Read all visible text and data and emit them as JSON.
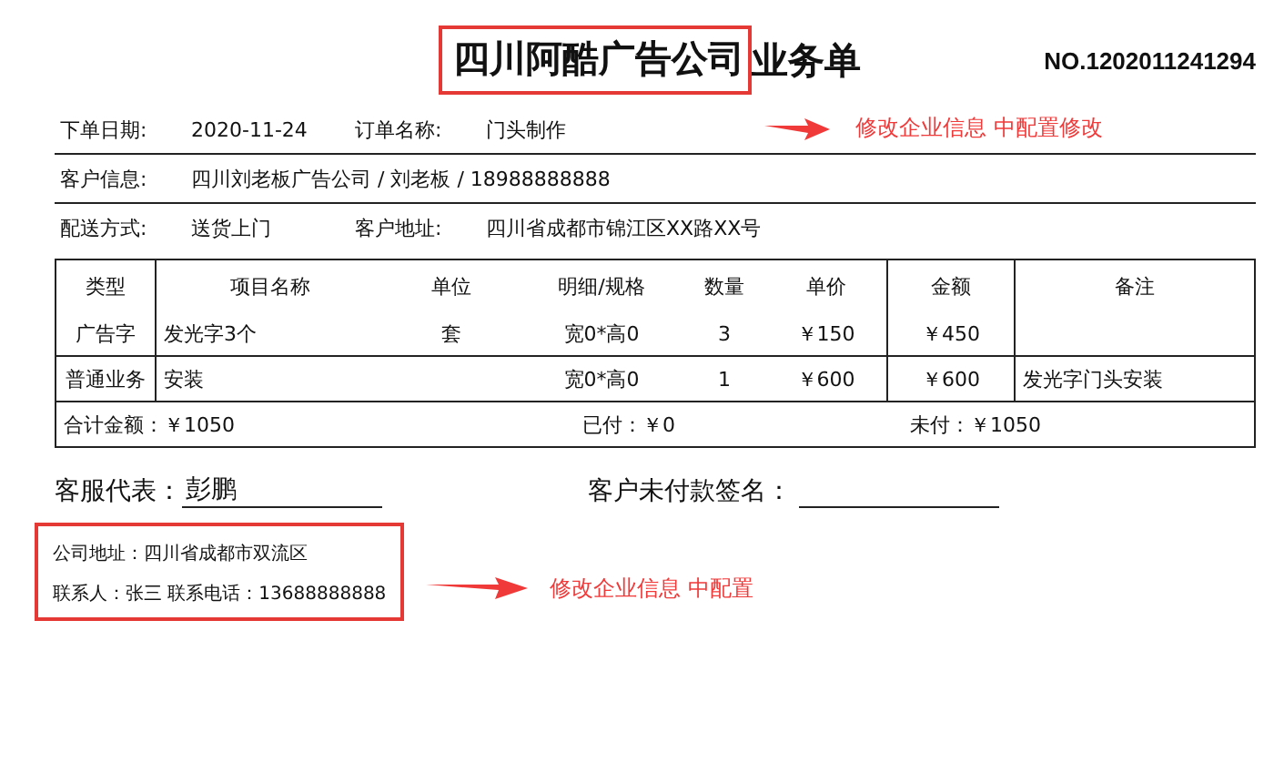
{
  "header": {
    "title_highlighted": "四川阿酷广告公司",
    "title_rest": "业务单",
    "number": "NO.1202011241294"
  },
  "annotations": [
    {
      "text": "修改企业信息 中配置修改"
    },
    {
      "text": "修改企业信息  中配置"
    }
  ],
  "info_rows": [
    [
      {
        "label": "下单日期:",
        "value": "2020-11-24"
      },
      {
        "label": "订单名称:",
        "value": "门头制作"
      }
    ],
    [
      {
        "label": "客户信息:",
        "value": "四川刘老板广告公司 / 刘老板 / 18988888888"
      }
    ],
    [
      {
        "label": "配送方式:",
        "value": "送货上门"
      },
      {
        "label": "客户地址:",
        "value": "四川省成都市锦江区XX路XX号"
      }
    ]
  ],
  "table": {
    "columns": [
      "类型",
      "项目名称",
      "单位",
      "明细/规格",
      "数量",
      "单价",
      "金额",
      "备注"
    ],
    "rows": [
      {
        "type": "广告字",
        "name": "发光字3个",
        "unit": "套",
        "spec": "宽0*高0",
        "qty": "3",
        "price": "￥150",
        "amount": "￥450"
      },
      {
        "type": "普通业务",
        "name": "安装",
        "spec": "宽0*高0",
        "qty": "1",
        "price": "￥600",
        "amount": "￥600",
        "remark": "发光字门头安装"
      }
    ]
  },
  "totals": [
    {
      "label": "合计金额：",
      "value": "￥1050"
    },
    {
      "label": "已付：",
      "value": "￥0"
    },
    {
      "label": "未付：",
      "value": "￥1050"
    }
  ],
  "signatures": {
    "rep_label": "客服代表：",
    "rep_name": "彭鹏",
    "customer_label": "客户未付款签名："
  },
  "company": {
    "address": "公司地址：四川省成都市双流区",
    "contact": "联系人：张三 联系电话：13688888888"
  }
}
